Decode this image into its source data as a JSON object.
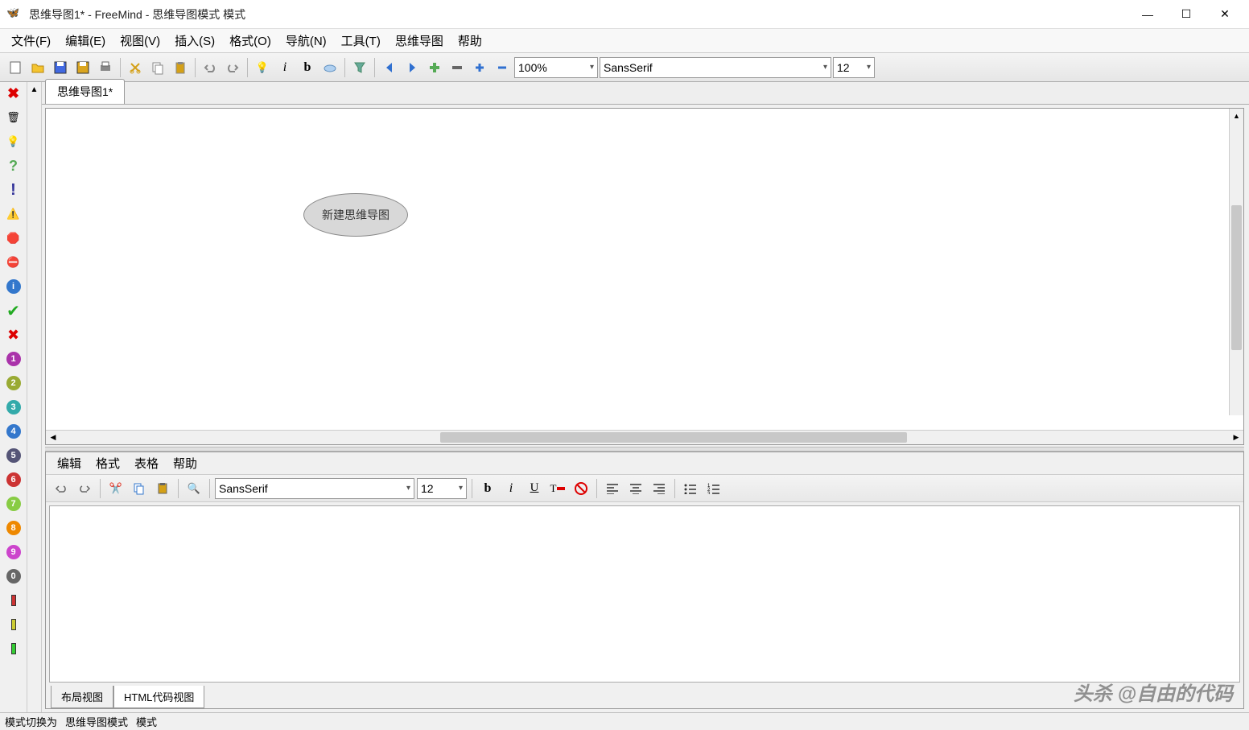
{
  "window": {
    "title": "思维导图1* - FreeMind - 思维导图模式 模式"
  },
  "menubar": {
    "file": "文件(F)",
    "edit": "编辑(E)",
    "view": "视图(V)",
    "insert": "插入(S)",
    "format": "格式(O)",
    "navigate": "导航(N)",
    "tools": "工具(T)",
    "mindmap": "思维导图",
    "help": "帮助"
  },
  "toolbar": {
    "zoom": "100%",
    "font": "SansSerif",
    "fontsize": "12"
  },
  "tabs": {
    "map": "思维导图1*"
  },
  "canvas": {
    "root_node": "新建思维导图"
  },
  "editor": {
    "menu": {
      "edit": "编辑",
      "format": "格式",
      "table": "表格",
      "help": "帮助"
    },
    "font": "SansSerif",
    "fontsize": "12",
    "tabs": {
      "layout": "布局视图",
      "html": "HTML代码视图"
    }
  },
  "statusbar": {
    "mode_switch": "模式切换为",
    "mode_name": "思维导图模式",
    "mode_label": "模式"
  },
  "watermark": "头杀 @自由的代码",
  "icons": {
    "butterfly": "🦋"
  }
}
